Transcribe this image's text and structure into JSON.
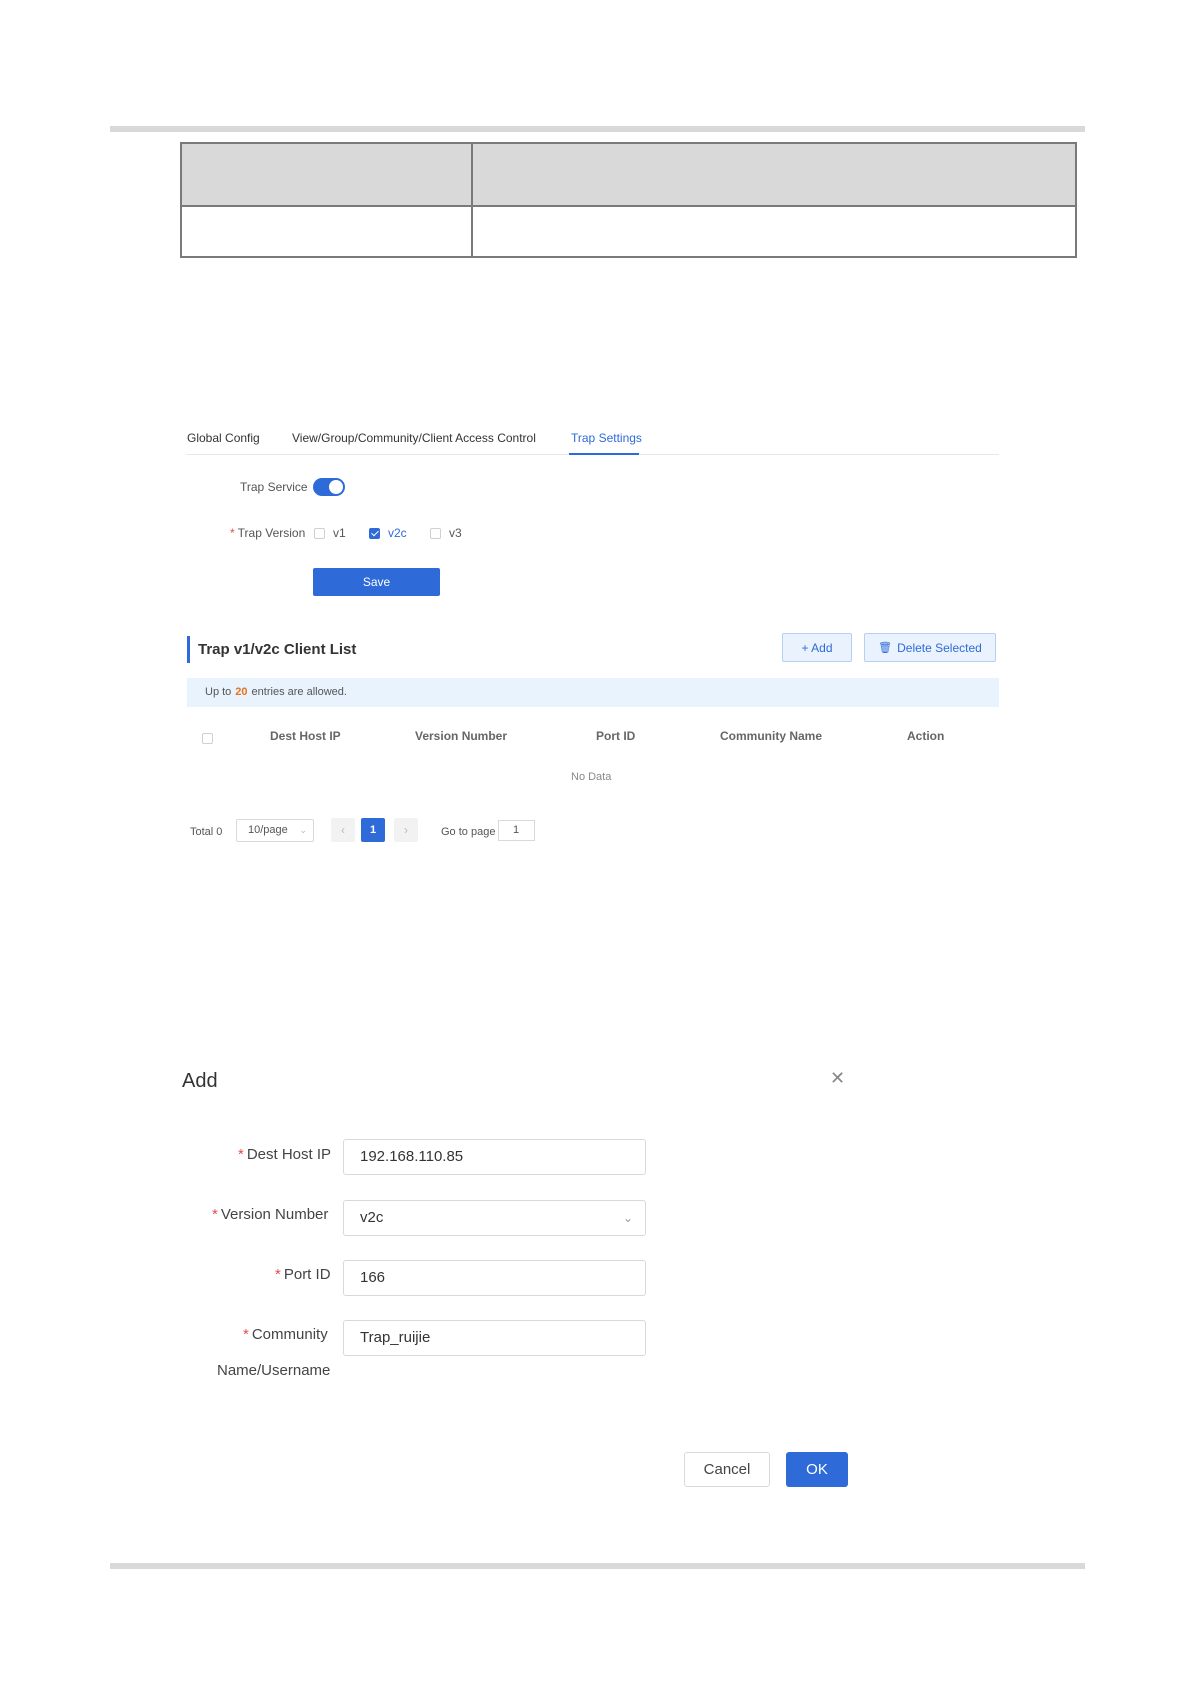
{
  "trap_settings": {
    "tabs": [
      {
        "label": "Global Config"
      },
      {
        "label": "View/Group/Community/Client Access Control"
      },
      {
        "label": "Trap Settings"
      }
    ],
    "trap_service_label": "Trap Service",
    "trap_service_enabled": true,
    "trap_version_label": "Trap Version",
    "versions": [
      {
        "label": "v1",
        "checked": false
      },
      {
        "label": "v2c",
        "checked": true
      },
      {
        "label": "v3",
        "checked": false
      }
    ],
    "save_label": "Save",
    "list_title": "Trap v1/v2c Client List",
    "add_label": "+ Add",
    "delete_label": "Delete Selected",
    "info_prefix": "Up to",
    "info_count": "20",
    "info_suffix": "entries are allowed.",
    "columns": [
      "Dest Host IP",
      "Version Number",
      "Port ID",
      "Community Name",
      "Action"
    ],
    "no_data": "No Data",
    "pagination": {
      "total": "Total 0",
      "page_size": "10/page",
      "current_page": "1",
      "go_to_label": "Go to page",
      "go_to_value": "1"
    }
  },
  "add_dialog": {
    "title": "Add",
    "fields": {
      "dest_host_ip": {
        "label": "Dest Host IP",
        "value": "192.168.110.85"
      },
      "version_number": {
        "label": "Version Number",
        "value": "v2c"
      },
      "port_id": {
        "label": "Port ID",
        "value": "166"
      },
      "community": {
        "label_line1": "Community",
        "label_line2": "Name/Username",
        "value": "Trap_ruijie"
      }
    },
    "cancel_label": "Cancel",
    "ok_label": "OK"
  },
  "colors": {
    "accent": "#2f6bd8",
    "highlight": "#e8731a",
    "required": "#e34d4d"
  }
}
